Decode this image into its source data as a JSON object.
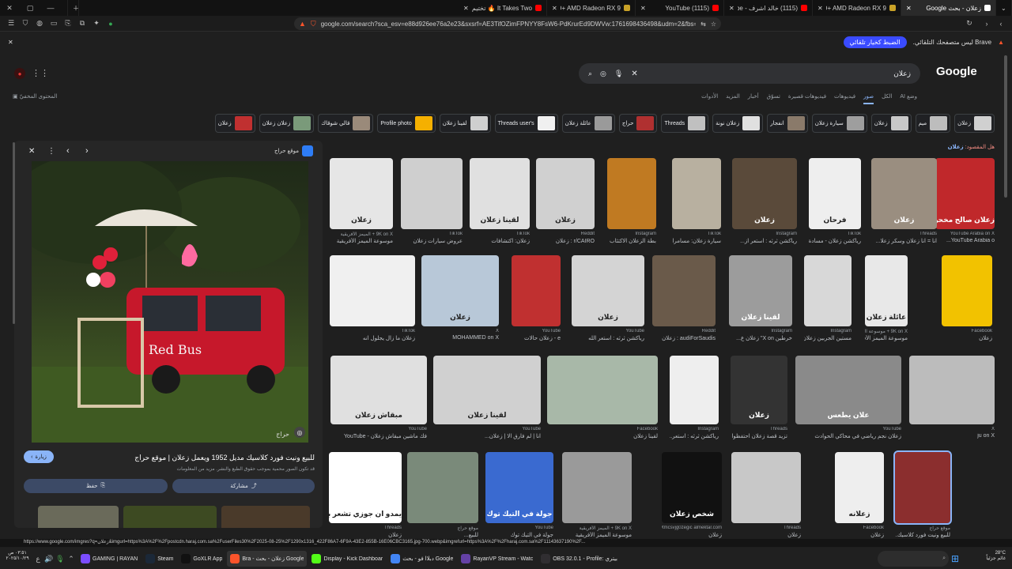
{
  "tabs": [
    {
      "label": "زعلان - بحث Google",
      "active": true,
      "color": "#ffffff"
    },
    {
      "label": "Sapphire NITRO+ AMD Radeon RX 9",
      "active": false,
      "color": "#c9a227"
    },
    {
      "label": "(1115) خالد اشرف - YouTube",
      "active": false,
      "color": "#ff0000"
    },
    {
      "label": "(1115) YouTube",
      "active": false,
      "color": "#ff0000"
    },
    {
      "label": "Sapphire NITRO+ AMD Radeon RX 9",
      "active": false,
      "color": "#c9a227"
    },
    {
      "label": "It Takes Two 🔥 تختيم لعبة مع أبو",
      "active": false,
      "color": "#ff0000"
    }
  ],
  "address": {
    "url": "google.com/search?sca_esv=e88d926ee76a2e23&sxsrf=AE3TifOZimFPNYY8FsW6-PdKrurEd9DWVw:1761698436498&udm=2&fbs=AIIjpHya8HJaG7G..."
  },
  "infobar": {
    "message": "Brave ليس متصفحك التلقائي.",
    "button": "الضبط كخيار تلقائي"
  },
  "search": {
    "logo": "Google",
    "query": "زعلان"
  },
  "nav_tabs": [
    "وضع AI",
    "الكل",
    "صور",
    "فيديوهات",
    "فيديوهات قصيرة",
    "تسوّق",
    "أخبار",
    "المزيد",
    "الأدوات"
  ],
  "safe": "المحتوى المخفيّ",
  "chips": [
    "زعلان",
    "ميم",
    "زعلان",
    "سيارة زعلان",
    "انفجار",
    "زعلان نونة",
    "Threads",
    "حراج",
    "عائلة زعلان",
    "Threads user's",
    "لقينا زعلان",
    "Profile photo",
    "قالي شوقاك",
    "زعلان زعلان",
    "زعلان"
  ],
  "didyoumean": {
    "prefix": "هل المقصود:",
    "term": "زعلان"
  },
  "panel": {
    "site": "موقع حراج",
    "title": "للبيع ونيت فورد كلاسيك مديل 1952 ويعمل زعلان | موقع حراج",
    "note": "قد تكون الصور محمية بموجب حقوق الطبع والنشر. مزيد من المعلومات",
    "visit": "زيارة",
    "share": "مشاركة",
    "save": "حفظ",
    "watermark": "حراج"
  },
  "grid": [
    {
      "src": "YouTube Arabia on X",
      "cap": "YouTube Arabia o...",
      "color": "#c0282b",
      "text": "زعلان صالح مخحون"
    },
    {
      "src": "Threads",
      "cap": "انا = انا زعلان وسكر زعلا...",
      "color": "#9a8e80",
      "text": "زعلان"
    },
    {
      "src": "TikTok",
      "cap": "ريأكشن زعلان - مسادة",
      "color": "#eeeeee",
      "text": "فرحان"
    },
    {
      "src": "Instagram",
      "cap": "ريأكشن ثرثه : استعر از...",
      "color": "#5a4a3a",
      "text": "زعلان"
    },
    {
      "src": "TikTok",
      "cap": "سيارة زعلان: مسامرات",
      "color": "#b8b0a0",
      "text": ""
    },
    {
      "src": "Instagram",
      "cap": "بطة الزعلان الاكتئاب",
      "color": "#c07a22",
      "text": ""
    },
    {
      "src": "Reddit",
      "cap": "r/CAIRO : زعلان",
      "color": "#d0d0d0",
      "text": "زعلان"
    },
    {
      "src": "TikTok",
      "cap": "زعلان: اكتشافات",
      "color": "#e0e0e0",
      "text": "لقينا زعلان"
    },
    {
      "src": "TikTok",
      "cap": "عروض سيارات زعلان",
      "color": "#cfcfcf",
      "text": ""
    },
    {
      "src": "9K on X + الميمز الأفريقية",
      "cap": "موسوعة الميمز الأفريقية",
      "color": "#e6e6e6",
      "text": "زعلان"
    },
    {
      "src": "Facebook",
      "cap": "زعلان",
      "color": "#f2c200",
      "text": ""
    },
    {
      "src": "9K on X + موسوعة الميمز",
      "cap": "موسوعة الميمز الأفريقية",
      "color": "#e8e8e8",
      "text": "عائلة زعلان"
    },
    {
      "src": "Instagram",
      "cap": "مستين الجربين زعلان",
      "color": "#d8d8d8",
      "text": ""
    },
    {
      "src": "Instagram",
      "cap": "خرطين X on\" زعلان ع...",
      "color": "#9c9c9c",
      "text": "لقينا زعلان"
    },
    {
      "src": "Reddit",
      "cap": "audiForSaudis : زعلان",
      "color": "#6a5a4a",
      "text": ""
    },
    {
      "src": "YouTube",
      "cap": "ريأكشن ثرثه : استعر الله",
      "color": "#d4d4d4",
      "text": "زعلان"
    },
    {
      "src": "YouTube",
      "cap": "e - زعلان حالات",
      "color": "#c03030",
      "text": ""
    },
    {
      "src": "X",
      "cap": "MOHAMMED on X",
      "color": "#b8c8d8",
      "text": "زعلان"
    },
    {
      "src": "TikTok",
      "cap": "زعلان ما زال يجلول انه",
      "color": "#f0f0f0",
      "text": ""
    },
    {
      "src": "X",
      "cap": "ju on X",
      "color": "#bcbcbc",
      "text": ""
    },
    {
      "src": "YouTube",
      "cap": "زعلان نجم رياضي في محاكي الحوادث",
      "color": "#8a8a8a",
      "text": "علان يطعس"
    },
    {
      "src": "Threads",
      "cap": "تزيد قصة زعلان احتفظوا انا ما عندك...",
      "color": "#333333",
      "text": "زعلان"
    },
    {
      "src": "Instagram",
      "cap": "ريأكشن ثرثه : استعر...",
      "color": "#eeeeee",
      "text": ""
    },
    {
      "src": "Facebook",
      "cap": "لقينا زعلان",
      "color": "#a8b8a8",
      "text": ""
    },
    {
      "src": "YouTube",
      "cap": "انا | لم فارق الا | زعلان...",
      "color": "#d0d0d0",
      "text": "لقينا زعلان"
    },
    {
      "src": "YouTube",
      "cap": "فك ماشين مبقاش زعلان - YouTube",
      "color": "#e0e0e0",
      "text": "مبقاش زعلان"
    },
    {
      "src": "موقع حراج",
      "cap": "للبيع ونيت فورد كلاسيك...",
      "color": "#8b2e2e",
      "text": ""
    },
    {
      "src": "Facebook",
      "cap": "زعلان",
      "color": "#eeeeee",
      "text": "زعلانه"
    },
    {
      "src": "Threads",
      "cap": "زعلان",
      "color": "#c8c8c8",
      "text": ""
    },
    {
      "src": "ytmcsvjg0zegic almektar.com",
      "cap": "زعلان",
      "color": "#111111",
      "text": "شخص زعلان"
    },
    {
      "src": "9K on X + الميمز الأفريقية",
      "cap": "موسوعة الميمز الأفريقية",
      "color": "#9a9a9a",
      "text": ""
    },
    {
      "src": "YouTube",
      "cap": "جولة في التيك توك",
      "color": "#3a6ad0",
      "text": "جولة في التيك توك"
    },
    {
      "src": "موقع حراج",
      "cap": "للبيع...",
      "color": "#7a8a7a",
      "text": ""
    },
    {
      "src": "Threads",
      "cap": "زعلان",
      "color": "#ffffff",
      "text": "يمدو ان جوزي تشعر بشي ماكي عليه"
    }
  ],
  "statusbar": "https://www.google.com/imgres?q=زعلان&imgurl=https%3A%2F%2Fpostcdn.haraj.com.sa%2FuserFiles30%2F2025-08-25%2F1290x1316_422F86A7-6F9A-43E2-855B-16E06CBC3165.jpg-700.webp&imgrefurl=https%3A%2F%2Fharaj.com.sa%2F11143637190%2F...",
  "taskbar": [
    {
      "label": "GAMING | RAYAN",
      "color": "#7b4dff"
    },
    {
      "label": "Steam",
      "color": "#1b2838"
    },
    {
      "label": "GoXLR App",
      "color": "#111111"
    },
    {
      "label": "Bra - زعلان - بحث Google",
      "color": "#fb542b"
    },
    {
      "label": "Display - Kick Dashboar",
      "color": "#53fc18"
    },
    {
      "label": "دبلاا فو - بحث Google",
      "color": "#4285f4"
    },
    {
      "label": "RayanVP Stream - Watc",
      "color": "#6441a5"
    },
    {
      "label": "OBS 32.0.1 - Profile: بيتري",
      "color": "#302e31"
    }
  ],
  "tray": {
    "weather": "28°C",
    "weather_desc": "غائم جزئياً",
    "time": "٠٣:٥١ ص",
    "date": "٢٠٢٥/١٠/٢٩"
  }
}
